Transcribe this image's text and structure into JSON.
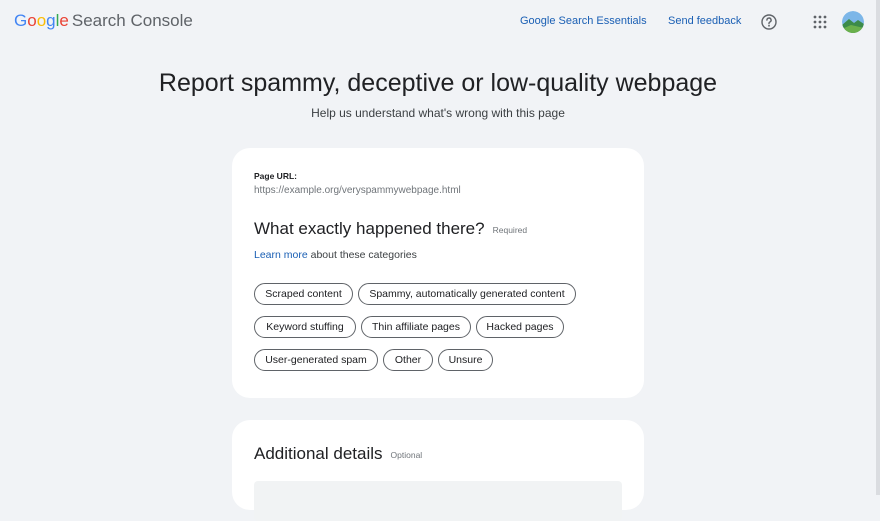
{
  "header": {
    "logo_google": [
      "G",
      "o",
      "o",
      "g",
      "l",
      "e"
    ],
    "logo_product": "Search Console",
    "nav_essentials": "Google Search Essentials",
    "nav_feedback": "Send feedback"
  },
  "colors": {
    "google_blue": "#4285F4",
    "google_red": "#EA4335",
    "google_yellow": "#FBBC05",
    "google_green": "#34A853",
    "link": "#1a5fb4",
    "background": "#f1f3f6"
  },
  "page": {
    "title": "Report spammy, deceptive or low-quality webpage",
    "subtitle": "Help us understand what's wrong with this page"
  },
  "form": {
    "url_label": "Page URL:",
    "url_value": "https://example.org/veryspammywebpage.html",
    "question": "What exactly happened there?",
    "required": "Required",
    "learn_more": "Learn more",
    "learn_more_rest": " about these categories",
    "categories": [
      "Scraped content",
      "Spammy, automatically generated content",
      "Keyword stuffing",
      "Thin affiliate pages",
      "Hacked pages",
      "User-generated spam",
      "Other",
      "Unsure"
    ]
  },
  "details": {
    "title": "Additional details",
    "optional": "Optional"
  }
}
